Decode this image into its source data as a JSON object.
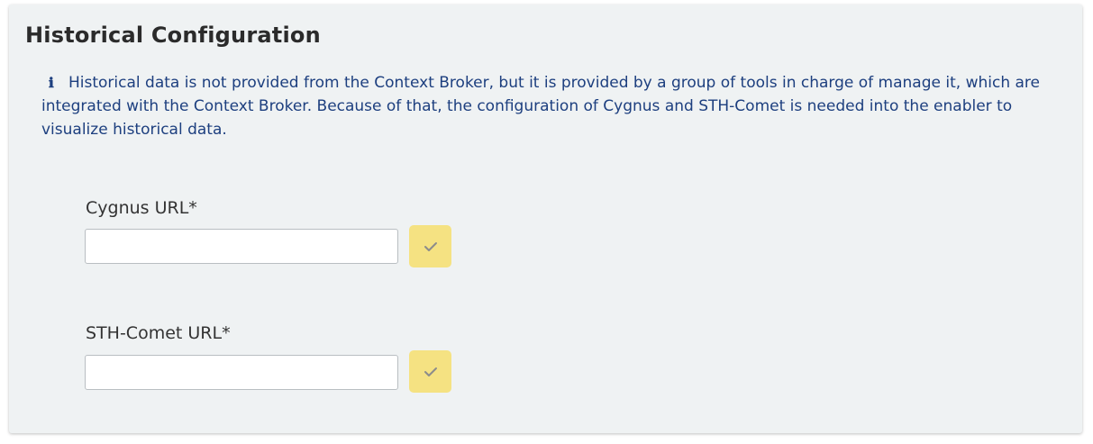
{
  "panel": {
    "title": "Historical Configuration",
    "info_icon": "ℹ",
    "info_text": "Historical data is not provided from the Context Broker, but it is provided by a group of tools in charge of manage it, which are integrated with the Context Broker. Because of that, the configuration of Cygnus and STH-Comet is needed into the enabler to visualize historical data."
  },
  "fields": {
    "cygnus": {
      "label": "Cygnus URL*",
      "value": "",
      "button_icon": "check-icon"
    },
    "sth_comet": {
      "label": "STH-Comet URL*",
      "value": "",
      "button_icon": "check-icon"
    }
  },
  "colors": {
    "panel_background": "#eff2f3",
    "info_text": "#1d3f7f",
    "check_button": "#f5e282",
    "check_icon": "#8c8c8c"
  }
}
